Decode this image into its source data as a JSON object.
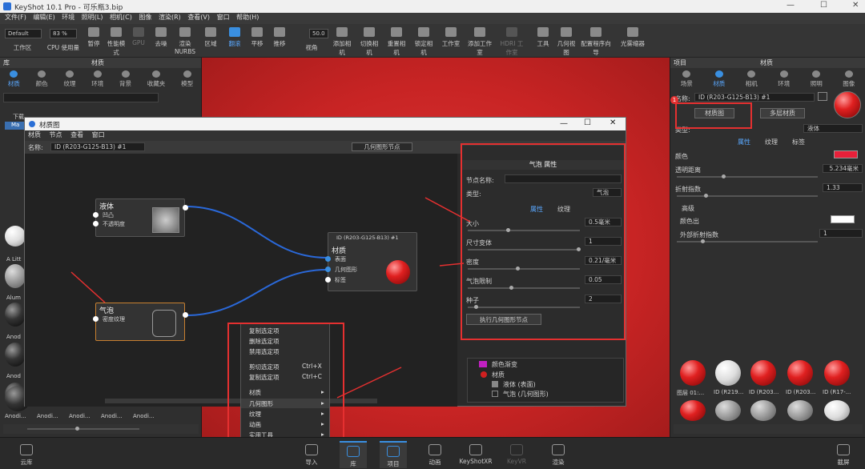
{
  "app": {
    "title": "KeyShot 10.1 Pro - 可乐瓶3.bip"
  },
  "menubar": [
    "文件(F)",
    "编辑(E)",
    "环境",
    "照明(L)",
    "相机(C)",
    "图像",
    "渲染(R)",
    "查看(V)",
    "窗口",
    "帮助(H)"
  ],
  "toolbar": {
    "preset": "Default",
    "zoom": "83 %",
    "fov": "50.0",
    "items": [
      "工作区",
      "CPU 使用量",
      "暂停",
      "性能模式",
      "GPU",
      "去噪",
      "渲染NURBS",
      "区域",
      "翻滚",
      "平移",
      "推移",
      "视角",
      "添加相机",
      "切换相机",
      "重置相机",
      "锁定相机",
      "工作室",
      "添加工作室",
      "HDRI 工作室",
      "工具",
      "几何视图",
      "配置程序向导",
      "光雾缩器"
    ]
  },
  "left_panel": {
    "title": "库",
    "sub_title": "材质",
    "tabs": [
      "材质",
      "颜色",
      "纹理",
      "环境",
      "背景",
      "收藏夹",
      "模型"
    ],
    "tree_root": "下载",
    "tree_item": "Ma",
    "thumbs": [
      "A Litt",
      "Alum",
      "Anod",
      "Anod",
      "Anodi..."
    ],
    "bottom_thumbs": [
      "Anodi...",
      "Anodi...",
      "Anodi...",
      "Anodi...",
      "Anodi..."
    ]
  },
  "right_panel": {
    "title": "项目",
    "sub_title": "材质",
    "tabs": [
      "场景",
      "材质",
      "相机",
      "环境",
      "照明",
      "图像"
    ],
    "name_label": "名称:",
    "name_value": "ID (R203-G125-B13) #1",
    "badge": "1",
    "material_graph_btn": "材质图",
    "multi_material_btn": "多层材质",
    "type_label": "类型:",
    "type_value": "液体",
    "sub_tabs": [
      "属性",
      "纹理",
      "标签"
    ],
    "color_label": "颜色",
    "trans_label": "透明距离",
    "trans_value": "5.234毫米",
    "refr_label": "折射指数",
    "refr_value": "1.33",
    "advanced": "高级",
    "color_out": "颜色出",
    "ext_refr_label": "外部折射指数",
    "ext_refr_value": "1",
    "thumbs": [
      "图层 01:...",
      "ID (R219...",
      "ID (R203...",
      "ID (R203...",
      "ID (R17-..."
    ]
  },
  "dialog": {
    "title": "材质图",
    "menu": [
      "材质",
      "节点",
      "查看",
      "窗口"
    ],
    "name_label": "名称:",
    "name_value": "ID (R203-G125-B13) #1",
    "geo_node_btn": "几何图形节点",
    "node_liquid": {
      "title": "液体",
      "ports": [
        "凹凸",
        "不透明度"
      ]
    },
    "node_material": {
      "header": "ID (R203-G125-B13) #1",
      "title": "材质",
      "ports": [
        "表面",
        "几何图形",
        "标签"
      ]
    },
    "node_bubble": {
      "title": "气泡",
      "ports": [
        "密度纹理"
      ]
    },
    "props": {
      "title": "气泡 属性",
      "node_name_label": "节点名称:",
      "type_label": "类型:",
      "type_value": "气泡",
      "tabs": [
        "属性",
        "纹理"
      ],
      "size_label": "大小",
      "size_value": "0.5毫米",
      "scale_label": "尺寸变体",
      "scale_value": "1",
      "density_label": "密度",
      "density_value": "0.21/毫米",
      "limit_label": "气泡限制",
      "limit_value": "0.05",
      "seed_label": "种子",
      "seed_value": "2",
      "exec_btn": "执行几何图形节点"
    },
    "tree": [
      "颜色渐变",
      "材质",
      "液体 (表面)",
      "气泡 (几何图形)"
    ]
  },
  "context_menu": {
    "items": [
      "复制选定项",
      "删除选定项",
      "禁用选定项",
      "剪切选定项",
      "复制选定项",
      "材质",
      "几何图形",
      "纹理",
      "动画",
      "实用工具"
    ],
    "shortcuts": [
      "Ctrl+X",
      "Ctrl+C"
    ]
  },
  "statusbar": [
    "云库",
    "导入",
    "库",
    "项目",
    "动画",
    "KeyShotXR",
    "KeyVR",
    "渲染",
    "截屏"
  ]
}
